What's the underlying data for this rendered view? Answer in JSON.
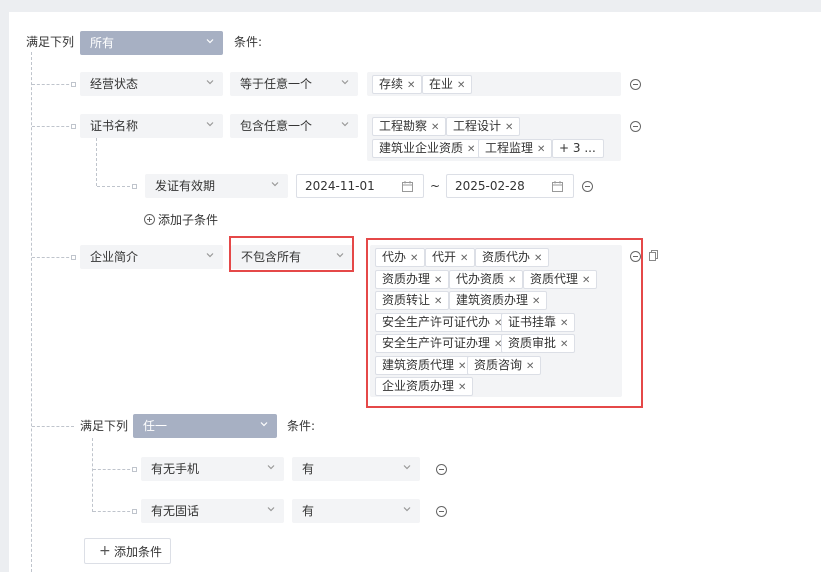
{
  "root": {
    "label": "满足下列",
    "mode": "所有",
    "suffix": "条件:"
  },
  "rules": [
    {
      "field": "经营状态",
      "op": "等于任意一个",
      "tags": [
        "存续",
        "在业"
      ]
    },
    {
      "field": "证书名称",
      "op": "包含任意一个",
      "tags": [
        "工程勘察",
        "工程设计",
        "建筑业企业资质",
        "工程监理"
      ],
      "more": "+ 3 ...",
      "sub": {
        "field": "发证有效期",
        "start": "2024-11-01",
        "sep": "~",
        "end": "2025-02-28"
      },
      "add_sub": "添加子条件"
    },
    {
      "field": "企业简介",
      "op": "不包含所有",
      "tags": [
        "代办",
        "代开",
        "资质代办",
        "资质办理",
        "代办资质",
        "资质代理",
        "资质转让",
        "建筑资质办理",
        "安全生产许可证代办",
        "证书挂靠",
        "安全生产许可证办理",
        "资质审批",
        "建筑资质代理",
        "资质咨询",
        "企业资质办理"
      ]
    }
  ],
  "group": {
    "label": "满足下列",
    "mode": "任一",
    "suffix": "条件:",
    "rules": [
      {
        "field": "有无手机",
        "value": "有"
      },
      {
        "field": "有无固话",
        "value": "有"
      }
    ]
  },
  "add_condition": "添加条件",
  "colors": {
    "highlight": "#e54848",
    "mode_bg": "#a7b0c3"
  }
}
